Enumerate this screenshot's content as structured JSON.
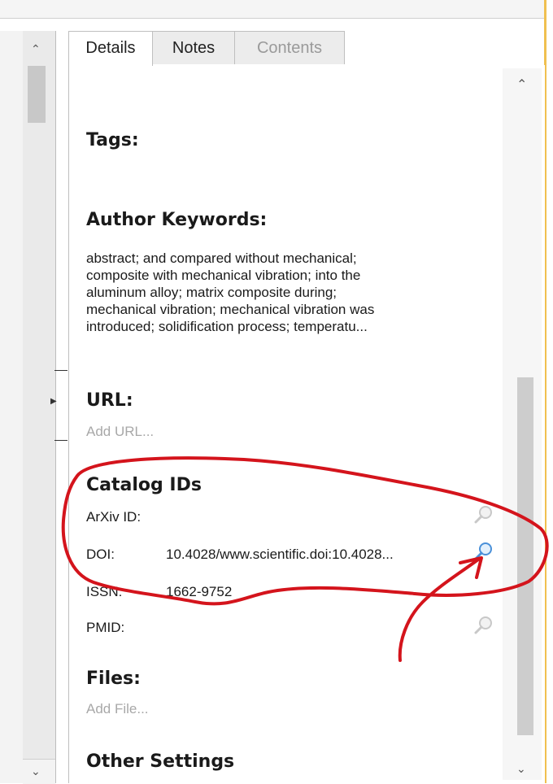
{
  "tabs": [
    {
      "label": "Details"
    },
    {
      "label": "Notes"
    },
    {
      "label": "Contents"
    }
  ],
  "sections": {
    "tags": {
      "heading": "Tags:"
    },
    "author_keywords": {
      "heading": "Author Keywords:",
      "lines": [
        "abstract; and compared without mechanical;",
        "composite with mechanical vibration; into the",
        "aluminum alloy; matrix composite during;",
        "mechanical vibration; mechanical vibration was",
        "introduced; solidification process; temperatu..."
      ]
    },
    "url": {
      "heading": "URL:",
      "placeholder": "Add URL..."
    },
    "catalog_ids": {
      "heading": "Catalog IDs",
      "rows": [
        {
          "label": "ArXiv ID:",
          "value": ""
        },
        {
          "label": "DOI:",
          "value": "10.4028/www.scientific.doi:10.4028..."
        },
        {
          "label": "ISSN:",
          "value": "1662-9752"
        },
        {
          "label": "PMID:",
          "value": ""
        }
      ]
    },
    "files": {
      "heading": "Files:",
      "placeholder": "Add File..."
    },
    "other_settings": {
      "heading": "Other Settings"
    }
  },
  "icons": {
    "scroll_up": "chevron-up-icon",
    "scroll_down": "chevron-down-icon",
    "lookup": "magnifier-icon"
  },
  "colors": {
    "annotation": "#d4141c",
    "active_lookup": "#4a90d9",
    "inactive_lookup": "#c8c8c8"
  }
}
